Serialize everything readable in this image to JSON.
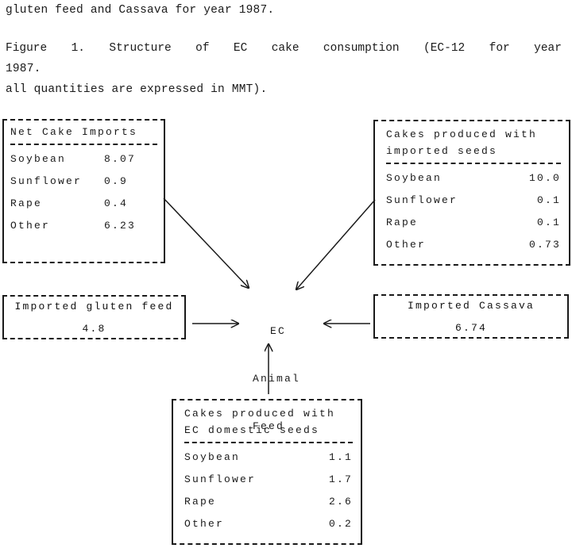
{
  "caption": {
    "line1": "gluten feed and Cassava for year 1987.",
    "line2_words": [
      "Figure",
      "1.",
      "Structure",
      "of",
      "EC",
      "cake",
      "consumption",
      "(EC-12",
      "for",
      "year"
    ],
    "line3": "1987.",
    "line4": "all quantities are expressed in MMT)."
  },
  "diagram": {
    "hub": {
      "line1": "EC",
      "line2": "Animal",
      "line3": "Feed"
    },
    "boxes": {
      "net_cake_imports": {
        "title": "Net Cake Imports",
        "rows": [
          {
            "label": "Soybean",
            "value": "8.07"
          },
          {
            "label": "Sunflower",
            "value": "0.9"
          },
          {
            "label": "Rape",
            "value": "0.4"
          },
          {
            "label": "Other",
            "value": "6.23"
          }
        ]
      },
      "cakes_imported_seeds": {
        "title_line1": "Cakes produced with",
        "title_line2": "imported seeds",
        "rows": [
          {
            "label": "Soybean",
            "value": "10.0"
          },
          {
            "label": "Sunflower",
            "value": "0.1"
          },
          {
            "label": "Rape",
            "value": "0.1"
          },
          {
            "label": "Other",
            "value": "0.73"
          }
        ]
      },
      "imported_gluten_feed": {
        "title": "Imported gluten feed",
        "value": "4.8"
      },
      "imported_cassava": {
        "title": "Imported Cassava",
        "value": "6.74"
      },
      "cakes_domestic_seeds": {
        "title_line1": "Cakes produced with",
        "title_line2": "EC domestic seeds",
        "rows": [
          {
            "label": "Soybean",
            "value": "1.1"
          },
          {
            "label": "Sunflower",
            "value": "1.7"
          },
          {
            "label": "Rape",
            "value": "2.6"
          },
          {
            "label": "Other",
            "value": "0.2"
          }
        ]
      }
    }
  },
  "chart_data": {
    "type": "diagram",
    "title": "Figure 1. Structure of EC cake consumption (EC-12 for year 1987. all quantities are expressed in MMT).",
    "units": "MMT",
    "year": 1987,
    "region": "EC-12",
    "center_node": "EC Animal Feed",
    "nodes": [
      {
        "name": "Net Cake Imports",
        "position": "top-left",
        "items": [
          {
            "name": "Soybean",
            "value": 8.07
          },
          {
            "name": "Sunflower",
            "value": 0.9
          },
          {
            "name": "Rape",
            "value": 0.4
          },
          {
            "name": "Other",
            "value": 6.23
          }
        ]
      },
      {
        "name": "Cakes produced with imported seeds",
        "position": "top-right",
        "items": [
          {
            "name": "Soybean",
            "value": 10.0
          },
          {
            "name": "Sunflower",
            "value": 0.1
          },
          {
            "name": "Rape",
            "value": 0.1
          },
          {
            "name": "Other",
            "value": 0.73
          }
        ]
      },
      {
        "name": "Imported gluten feed",
        "position": "middle-left",
        "items": [
          {
            "name": "Imported gluten feed",
            "value": 4.8
          }
        ]
      },
      {
        "name": "Imported Cassava",
        "position": "middle-right",
        "items": [
          {
            "name": "Imported Cassava",
            "value": 6.74
          }
        ]
      },
      {
        "name": "Cakes produced with EC domestic seeds",
        "position": "bottom-center",
        "items": [
          {
            "name": "Soybean",
            "value": 1.1
          },
          {
            "name": "Sunflower",
            "value": 1.7
          },
          {
            "name": "Rape",
            "value": 2.6
          },
          {
            "name": "Other",
            "value": 0.2
          }
        ]
      }
    ],
    "edges": [
      {
        "from": "Net Cake Imports",
        "to": "EC Animal Feed",
        "direction": "diagonal-down-right"
      },
      {
        "from": "Cakes produced with imported seeds",
        "to": "EC Animal Feed",
        "direction": "diagonal-down-left"
      },
      {
        "from": "Imported gluten feed",
        "to": "EC Animal Feed",
        "direction": "right"
      },
      {
        "from": "Imported Cassava",
        "to": "EC Animal Feed",
        "direction": "left"
      },
      {
        "from": "Cakes produced with EC domestic seeds",
        "to": "EC Animal Feed",
        "direction": "up"
      }
    ]
  }
}
